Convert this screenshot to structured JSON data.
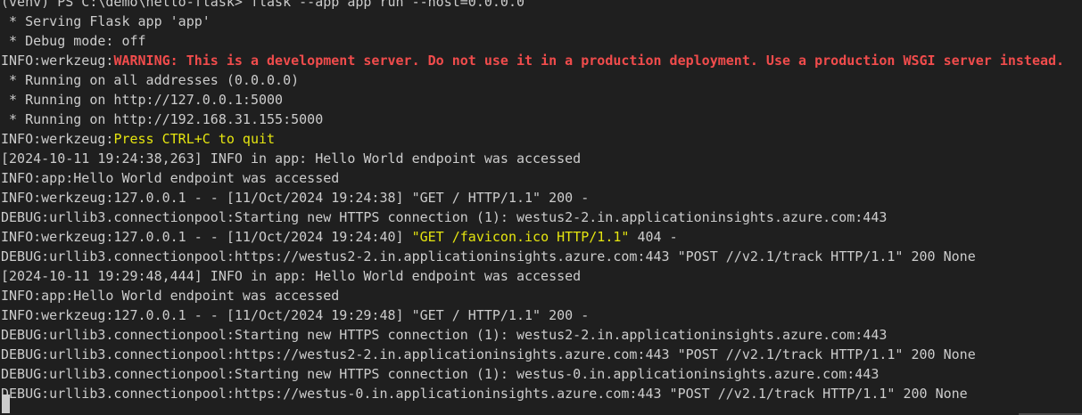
{
  "terminal": {
    "lines": [
      [
        {
          "text": "(venv) PS C:\\demo\\hello-flask> flask --app app run --host=0.0.0.0",
          "c": "plain"
        }
      ],
      [
        {
          "text": " * Serving Flask app 'app'",
          "c": "plain"
        }
      ],
      [
        {
          "text": " * Debug mode: off",
          "c": "plain"
        }
      ],
      [
        {
          "text": "INFO:werkzeug:",
          "c": "plain"
        },
        {
          "text": "WARNING: This is a development server. Do not use it in a production deployment. Use a production WSGI server instead.",
          "c": "warn"
        }
      ],
      [
        {
          "text": " * Running on all addresses (0.0.0.0)",
          "c": "plain"
        }
      ],
      [
        {
          "text": " * Running on http://127.0.0.1:5000",
          "c": "plain"
        }
      ],
      [
        {
          "text": " * Running on http://192.168.31.155:5000",
          "c": "plain"
        }
      ],
      [
        {
          "text": "INFO:werkzeug:",
          "c": "plain"
        },
        {
          "text": "Press CTRL+C to quit",
          "c": "yellow"
        }
      ],
      [
        {
          "text": "[2024-10-11 19:24:38,263] INFO in app: Hello World endpoint was accessed",
          "c": "plain"
        }
      ],
      [
        {
          "text": "INFO:app:Hello World endpoint was accessed",
          "c": "plain"
        }
      ],
      [
        {
          "text": "INFO:werkzeug:127.0.0.1 - - [11/Oct/2024 19:24:38] \"GET / HTTP/1.1\" 200 -",
          "c": "plain"
        }
      ],
      [
        {
          "text": "DEBUG:urllib3.connectionpool:Starting new HTTPS connection (1): westus2-2.in.applicationinsights.azure.com:443",
          "c": "plain"
        }
      ],
      [
        {
          "text": "INFO:werkzeug:127.0.0.1 - - [11/Oct/2024 19:24:40] ",
          "c": "plain"
        },
        {
          "text": "\"GET /favicon.ico HTTP/1.1\"",
          "c": "yellow"
        },
        {
          "text": " 404 -",
          "c": "plain"
        }
      ],
      [
        {
          "text": "DEBUG:urllib3.connectionpool:https://westus2-2.in.applicationinsights.azure.com:443 \"POST //v2.1/track HTTP/1.1\" 200 None",
          "c": "plain"
        }
      ],
      [
        {
          "text": "[2024-10-11 19:29:48,444] INFO in app: Hello World endpoint was accessed",
          "c": "plain"
        }
      ],
      [
        {
          "text": "INFO:app:Hello World endpoint was accessed",
          "c": "plain"
        }
      ],
      [
        {
          "text": "INFO:werkzeug:127.0.0.1 - - [11/Oct/2024 19:29:48] \"GET / HTTP/1.1\" 200 -",
          "c": "plain"
        }
      ],
      [
        {
          "text": "DEBUG:urllib3.connectionpool:Starting new HTTPS connection (1): westus2-2.in.applicationinsights.azure.com:443",
          "c": "plain"
        }
      ],
      [
        {
          "text": "DEBUG:urllib3.connectionpool:https://westus2-2.in.applicationinsights.azure.com:443 \"POST //v2.1/track HTTP/1.1\" 200 None",
          "c": "plain"
        }
      ],
      [
        {
          "text": "DEBUG:urllib3.connectionpool:Starting new HTTPS connection (1): westus-0.in.applicationinsights.azure.com:443",
          "c": "plain"
        }
      ],
      [
        {
          "text": "DEBUG:urllib3.connectionpool:https://westus-0.in.applicationinsights.azure.com:443 \"POST //v2.1/track HTTP/1.1\" 200 None",
          "c": "plain"
        }
      ]
    ]
  },
  "colors": {
    "background": "#1f1f1f",
    "foreground": "#cccccc",
    "warning": "#f14c4c",
    "highlight": "#e5e510"
  }
}
